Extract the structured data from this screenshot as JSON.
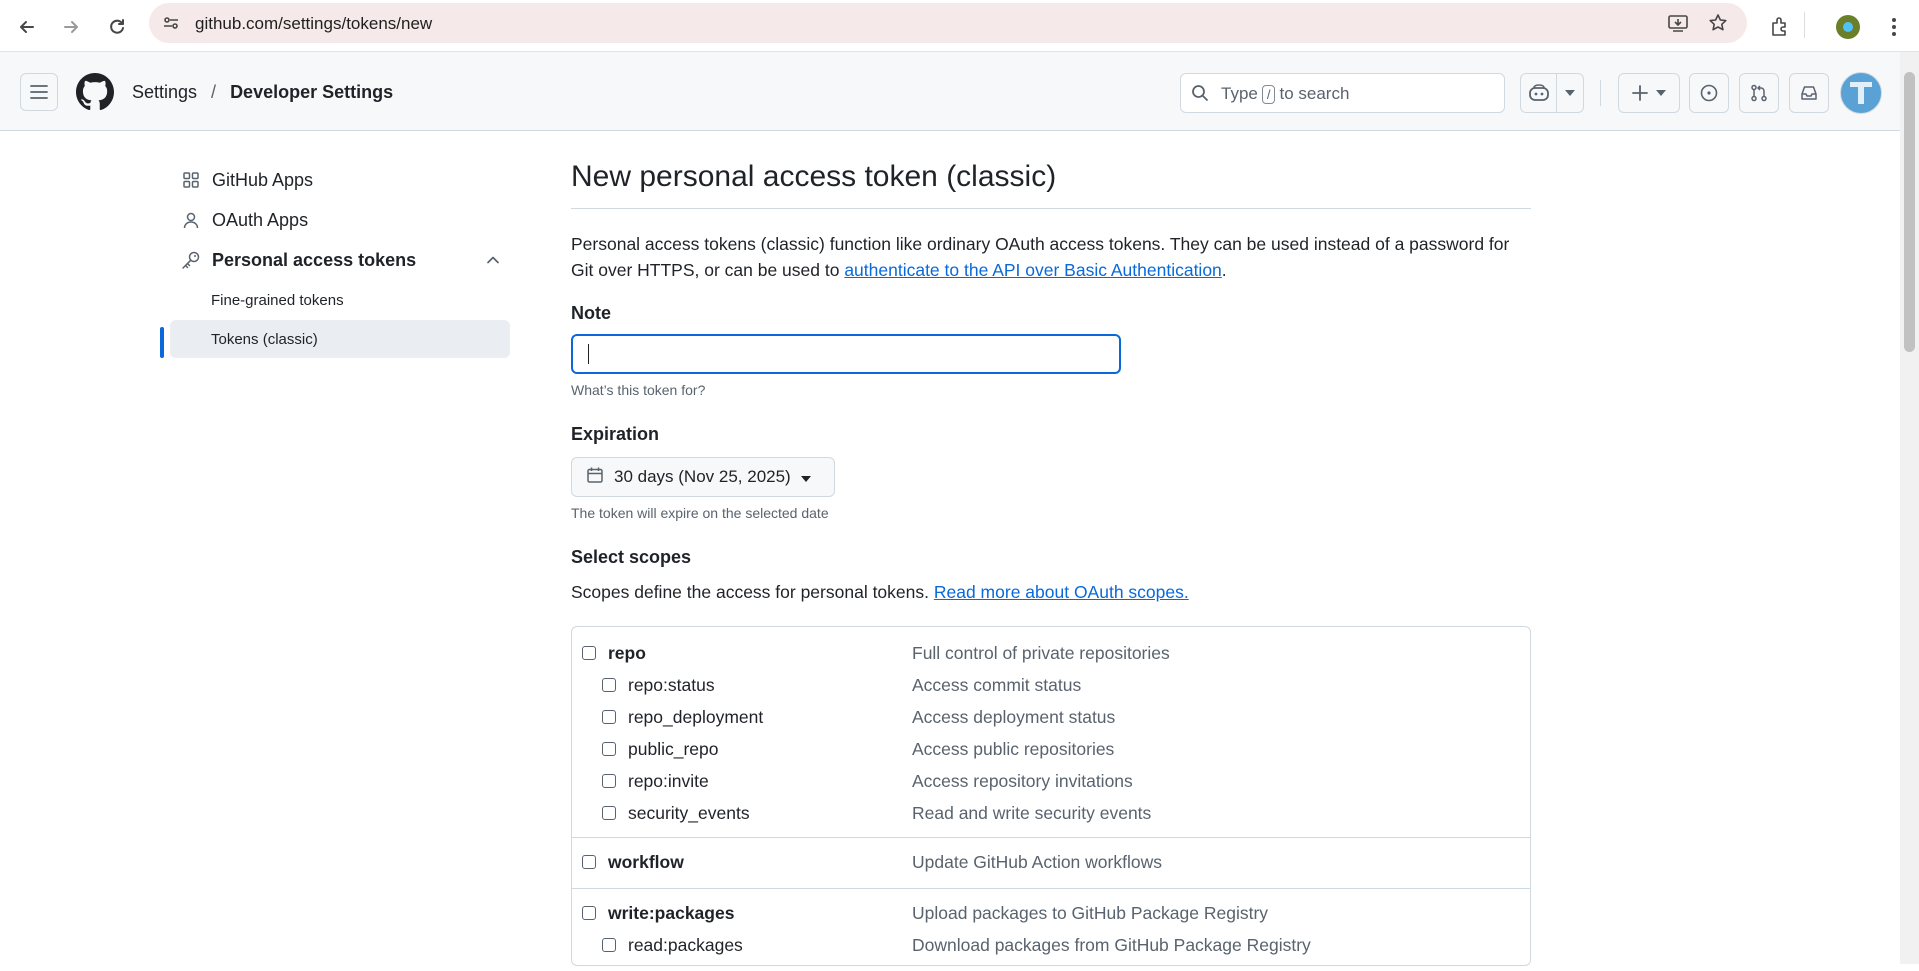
{
  "browser": {
    "url": "github.com/settings/tokens/new"
  },
  "header": {
    "breadcrumb": [
      "Settings",
      "Developer Settings"
    ],
    "breadcrumb_separator": "/",
    "search_prefix": "Type",
    "search_key": "/",
    "search_suffix": "to search"
  },
  "sidebar": {
    "items": [
      {
        "label": "GitHub Apps",
        "icon": "apps-icon"
      },
      {
        "label": "OAuth Apps",
        "icon": "person-icon"
      },
      {
        "label": "Personal access tokens",
        "icon": "key-icon"
      }
    ],
    "subitems": [
      {
        "label": "Fine-grained tokens"
      },
      {
        "label": "Tokens (classic)"
      }
    ]
  },
  "main": {
    "title": "New personal access token (classic)",
    "description": "Personal access tokens (classic) function like ordinary OAuth access tokens. They can be used instead of a password for Git over HTTPS, or can be used to ",
    "description_link": "authenticate to the API over Basic Authentication",
    "description_end": ".",
    "note_label": "Note",
    "note_value": "",
    "note_hint": "What’s this token for?",
    "expiration_label": "Expiration",
    "expiration_value": "30 days (Nov 25, 2025)",
    "expiration_hint": "The token will expire on the selected date",
    "scopes_label": "Select scopes",
    "scopes_desc": "Scopes define the access for personal tokens. ",
    "scopes_link": "Read more about OAuth scopes."
  },
  "scopes": {
    "repo": {
      "name": "repo",
      "desc": "Full control of private repositories"
    },
    "repo_subs": [
      {
        "name": "repo:status",
        "desc": "Access commit status"
      },
      {
        "name": "repo_deployment",
        "desc": "Access deployment status"
      },
      {
        "name": "public_repo",
        "desc": "Access public repositories"
      },
      {
        "name": "repo:invite",
        "desc": "Access repository invitations"
      },
      {
        "name": "security_events",
        "desc": "Read and write security events"
      }
    ],
    "workflow": {
      "name": "workflow",
      "desc": "Update GitHub Action workflows"
    },
    "write_packages": {
      "name": "write:packages",
      "desc": "Upload packages to GitHub Package Registry"
    },
    "read_packages": {
      "name": "read:packages",
      "desc": "Download packages from GitHub Package Registry"
    }
  },
  "colors": {
    "accent": "#0969da",
    "text": "#1f2328",
    "muted": "#59636e",
    "border": "#d1d9e0"
  }
}
